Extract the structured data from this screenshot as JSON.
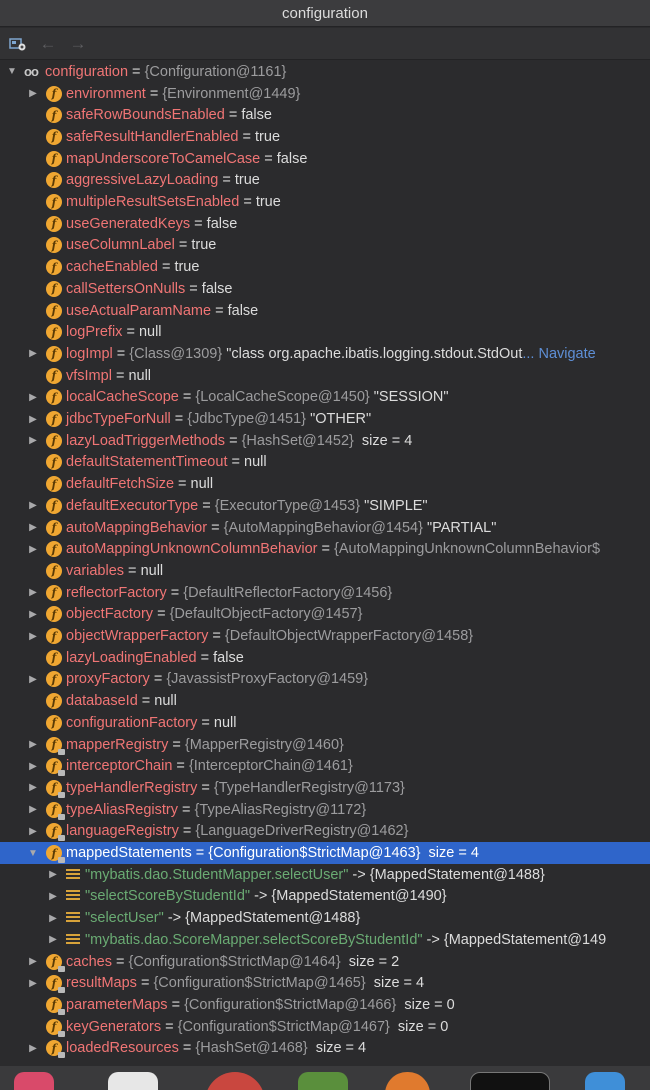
{
  "window": {
    "title": "configuration"
  },
  "toolbar": {
    "back_label": "←",
    "forward_label": "→"
  },
  "root": {
    "name": "configuration",
    "op": " = ",
    "ref": "{Configuration@1161}"
  },
  "rows": [
    {
      "depth": 1,
      "arrow": "collapsed",
      "icon": "field",
      "name": "environment",
      "op": " = ",
      "ref": "{Environment@1449}",
      "val": "",
      "nav": ""
    },
    {
      "depth": 1,
      "arrow": "none",
      "icon": "field",
      "name": "safeRowBoundsEnabled",
      "op": " = ",
      "ref": "",
      "val": "false",
      "nav": ""
    },
    {
      "depth": 1,
      "arrow": "none",
      "icon": "field",
      "name": "safeResultHandlerEnabled",
      "op": " = ",
      "ref": "",
      "val": "true",
      "nav": ""
    },
    {
      "depth": 1,
      "arrow": "none",
      "icon": "field",
      "name": "mapUnderscoreToCamelCase",
      "op": " = ",
      "ref": "",
      "val": "false",
      "nav": ""
    },
    {
      "depth": 1,
      "arrow": "none",
      "icon": "field",
      "name": "aggressiveLazyLoading",
      "op": " = ",
      "ref": "",
      "val": "true",
      "nav": ""
    },
    {
      "depth": 1,
      "arrow": "none",
      "icon": "field",
      "name": "multipleResultSetsEnabled",
      "op": " = ",
      "ref": "",
      "val": "true",
      "nav": ""
    },
    {
      "depth": 1,
      "arrow": "none",
      "icon": "field",
      "name": "useGeneratedKeys",
      "op": " = ",
      "ref": "",
      "val": "false",
      "nav": ""
    },
    {
      "depth": 1,
      "arrow": "none",
      "icon": "field",
      "name": "useColumnLabel",
      "op": " = ",
      "ref": "",
      "val": "true",
      "nav": ""
    },
    {
      "depth": 1,
      "arrow": "none",
      "icon": "field",
      "name": "cacheEnabled",
      "op": " = ",
      "ref": "",
      "val": "true",
      "nav": ""
    },
    {
      "depth": 1,
      "arrow": "none",
      "icon": "field",
      "name": "callSettersOnNulls",
      "op": " = ",
      "ref": "",
      "val": "false",
      "nav": ""
    },
    {
      "depth": 1,
      "arrow": "none",
      "icon": "field",
      "name": "useActualParamName",
      "op": " = ",
      "ref": "",
      "val": "false",
      "nav": ""
    },
    {
      "depth": 1,
      "arrow": "none",
      "icon": "field",
      "name": "logPrefix",
      "op": " = ",
      "ref": "",
      "val": "null",
      "nav": ""
    },
    {
      "depth": 1,
      "arrow": "collapsed",
      "icon": "field",
      "name": "logImpl",
      "op": " = ",
      "ref": "{Class@1309} ",
      "val": "\"class org.apache.ibatis.logging.stdout.StdOut",
      "nav": "... Navigate"
    },
    {
      "depth": 1,
      "arrow": "none",
      "icon": "field",
      "name": "vfsImpl",
      "op": " = ",
      "ref": "",
      "val": "null",
      "nav": ""
    },
    {
      "depth": 1,
      "arrow": "collapsed",
      "icon": "field",
      "name": "localCacheScope",
      "op": " = ",
      "ref": "{LocalCacheScope@1450} ",
      "val": "\"SESSION\"",
      "nav": ""
    },
    {
      "depth": 1,
      "arrow": "collapsed",
      "icon": "field",
      "name": "jdbcTypeForNull",
      "op": " = ",
      "ref": "{JdbcType@1451} ",
      "val": "\"OTHER\"",
      "nav": ""
    },
    {
      "depth": 1,
      "arrow": "collapsed",
      "icon": "field",
      "name": "lazyLoadTriggerMethods",
      "op": " = ",
      "ref": "{HashSet@1452} ",
      "val": " size = 4",
      "nav": ""
    },
    {
      "depth": 1,
      "arrow": "none",
      "icon": "field",
      "name": "defaultStatementTimeout",
      "op": " = ",
      "ref": "",
      "val": "null",
      "nav": ""
    },
    {
      "depth": 1,
      "arrow": "none",
      "icon": "field",
      "name": "defaultFetchSize",
      "op": " = ",
      "ref": "",
      "val": "null",
      "nav": ""
    },
    {
      "depth": 1,
      "arrow": "collapsed",
      "icon": "field",
      "name": "defaultExecutorType",
      "op": " = ",
      "ref": "{ExecutorType@1453} ",
      "val": "\"SIMPLE\"",
      "nav": ""
    },
    {
      "depth": 1,
      "arrow": "collapsed",
      "icon": "field",
      "name": "autoMappingBehavior",
      "op": " = ",
      "ref": "{AutoMappingBehavior@1454} ",
      "val": "\"PARTIAL\"",
      "nav": ""
    },
    {
      "depth": 1,
      "arrow": "collapsed",
      "icon": "field",
      "name": "autoMappingUnknownColumnBehavior",
      "op": " = ",
      "ref": "{AutoMappingUnknownColumnBehavior$",
      "val": "",
      "nav": ""
    },
    {
      "depth": 1,
      "arrow": "none",
      "icon": "field",
      "name": "variables",
      "op": " = ",
      "ref": "",
      "val": "null",
      "nav": ""
    },
    {
      "depth": 1,
      "arrow": "collapsed",
      "icon": "field",
      "name": "reflectorFactory",
      "op": " = ",
      "ref": "{DefaultReflectorFactory@1456}",
      "val": "",
      "nav": ""
    },
    {
      "depth": 1,
      "arrow": "collapsed",
      "icon": "field",
      "name": "objectFactory",
      "op": " = ",
      "ref": "{DefaultObjectFactory@1457}",
      "val": "",
      "nav": ""
    },
    {
      "depth": 1,
      "arrow": "collapsed",
      "icon": "field",
      "name": "objectWrapperFactory",
      "op": " = ",
      "ref": "{DefaultObjectWrapperFactory@1458}",
      "val": "",
      "nav": ""
    },
    {
      "depth": 1,
      "arrow": "none",
      "icon": "field",
      "name": "lazyLoadingEnabled",
      "op": " = ",
      "ref": "",
      "val": "false",
      "nav": ""
    },
    {
      "depth": 1,
      "arrow": "collapsed",
      "icon": "field",
      "name": "proxyFactory",
      "op": " = ",
      "ref": "{JavassistProxyFactory@1459}",
      "val": "",
      "nav": ""
    },
    {
      "depth": 1,
      "arrow": "none",
      "icon": "field",
      "name": "databaseId",
      "op": " = ",
      "ref": "",
      "val": "null",
      "nav": ""
    },
    {
      "depth": 1,
      "arrow": "none",
      "icon": "field",
      "name": "configurationFactory",
      "op": " = ",
      "ref": "",
      "val": "null",
      "nav": ""
    },
    {
      "depth": 1,
      "arrow": "collapsed",
      "icon": "field-final",
      "name": "mapperRegistry",
      "op": " = ",
      "ref": "{MapperRegistry@1460}",
      "val": "",
      "nav": ""
    },
    {
      "depth": 1,
      "arrow": "collapsed",
      "icon": "field-final",
      "name": "interceptorChain",
      "op": " = ",
      "ref": "{InterceptorChain@1461}",
      "val": "",
      "nav": ""
    },
    {
      "depth": 1,
      "arrow": "collapsed",
      "icon": "field-final",
      "name": "typeHandlerRegistry",
      "op": " = ",
      "ref": "{TypeHandlerRegistry@1173}",
      "val": "",
      "nav": ""
    },
    {
      "depth": 1,
      "arrow": "collapsed",
      "icon": "field-final",
      "name": "typeAliasRegistry",
      "op": " = ",
      "ref": "{TypeAliasRegistry@1172}",
      "val": "",
      "nav": ""
    },
    {
      "depth": 1,
      "arrow": "collapsed",
      "icon": "field-final",
      "name": "languageRegistry",
      "op": " = ",
      "ref": "{LanguageDriverRegistry@1462}",
      "val": "",
      "nav": ""
    },
    {
      "depth": 1,
      "arrow": "expanded",
      "icon": "field-final",
      "name": "mappedStatements",
      "op": " = ",
      "ref": "{Configuration$StrictMap@1463} ",
      "val": " size = 4",
      "nav": "",
      "selected": true
    },
    {
      "depth": 2,
      "arrow": "collapsed",
      "icon": "entry",
      "name": "",
      "op": "",
      "ref": "",
      "str": "\"mybatis.dao.StudentMapper.selectUser\"",
      "val": " -> {MappedStatement@1488}",
      "nav": ""
    },
    {
      "depth": 2,
      "arrow": "collapsed",
      "icon": "entry",
      "name": "",
      "op": "",
      "ref": "",
      "str": "\"selectScoreByStudentId\"",
      "val": " -> {MappedStatement@1490}",
      "nav": ""
    },
    {
      "depth": 2,
      "arrow": "collapsed",
      "icon": "entry",
      "name": "",
      "op": "",
      "ref": "",
      "str": "\"selectUser\"",
      "val": " -> {MappedStatement@1488}",
      "nav": ""
    },
    {
      "depth": 2,
      "arrow": "collapsed",
      "icon": "entry",
      "name": "",
      "op": "",
      "ref": "",
      "str": "\"mybatis.dao.ScoreMapper.selectScoreByStudentId\"",
      "val": " -> {MappedStatement@149",
      "nav": ""
    },
    {
      "depth": 1,
      "arrow": "collapsed",
      "icon": "field-final",
      "name": "caches",
      "op": " = ",
      "ref": "{Configuration$StrictMap@1464} ",
      "val": " size = 2",
      "nav": ""
    },
    {
      "depth": 1,
      "arrow": "collapsed",
      "icon": "field-final",
      "name": "resultMaps",
      "op": " = ",
      "ref": "{Configuration$StrictMap@1465} ",
      "val": " size = 4",
      "nav": ""
    },
    {
      "depth": 1,
      "arrow": "none",
      "icon": "field-final",
      "name": "parameterMaps",
      "op": " = ",
      "ref": "{Configuration$StrictMap@1466} ",
      "val": " size = 0",
      "nav": ""
    },
    {
      "depth": 1,
      "arrow": "none",
      "icon": "field-final",
      "name": "keyGenerators",
      "op": " = ",
      "ref": "{Configuration$StrictMap@1467} ",
      "val": " size = 0",
      "nav": ""
    },
    {
      "depth": 1,
      "arrow": "collapsed",
      "icon": "field-final",
      "name": "loadedResources",
      "op": " = ",
      "ref": "{HashSet@1468} ",
      "val": " size = 4",
      "nav": ""
    }
  ]
}
